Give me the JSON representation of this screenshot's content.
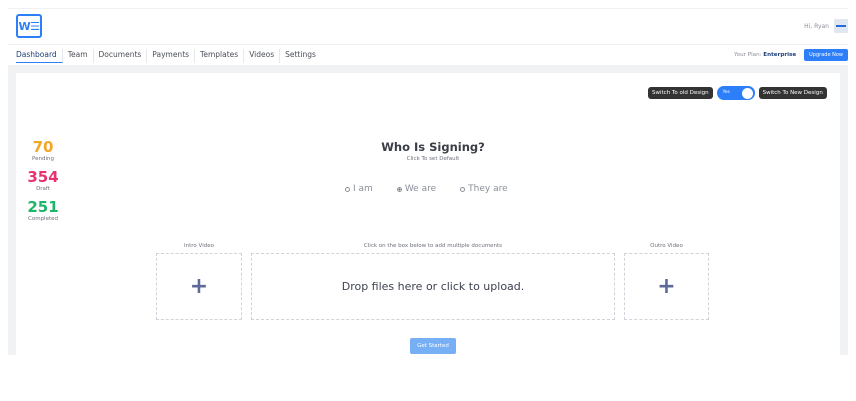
{
  "logo": {
    "text": "W☰"
  },
  "header": {
    "greeting": "Hi, Ryan"
  },
  "nav": {
    "tabs": [
      {
        "label": "Dashboard"
      },
      {
        "label": "Team"
      },
      {
        "label": "Documents"
      },
      {
        "label": "Payments"
      },
      {
        "label": "Templates"
      },
      {
        "label": "Videos"
      },
      {
        "label": "Settings"
      }
    ],
    "plan_prefix": "Your Plan:",
    "plan_name": "Enterprise",
    "upgrade_label": "Upgrade Now"
  },
  "design_toggle": {
    "old_label": "Switch To old Design",
    "toggle_text": "Yes",
    "new_label": "Switch To New Design",
    "accent": "#2d7ff9"
  },
  "stats": [
    {
      "value": "70",
      "label": "Pending",
      "color": "#f5a623"
    },
    {
      "value": "354",
      "label": "Draft",
      "color": "#e8336e"
    },
    {
      "value": "251",
      "label": "Completed",
      "color": "#1db56a"
    }
  ],
  "signing": {
    "title": "Who Is Signing?",
    "subtitle": "Click To set Default",
    "options": [
      "I am",
      "We are",
      "They are"
    ],
    "selected": "We are"
  },
  "uploads": {
    "intro_label": "Intro Video",
    "documents_label": "Click on the box below to add multiple documents",
    "outro_label": "Outro Video",
    "dropzone_text": "Drop files here or click to upload.",
    "plus": "+"
  },
  "get_started_label": "Get Started"
}
